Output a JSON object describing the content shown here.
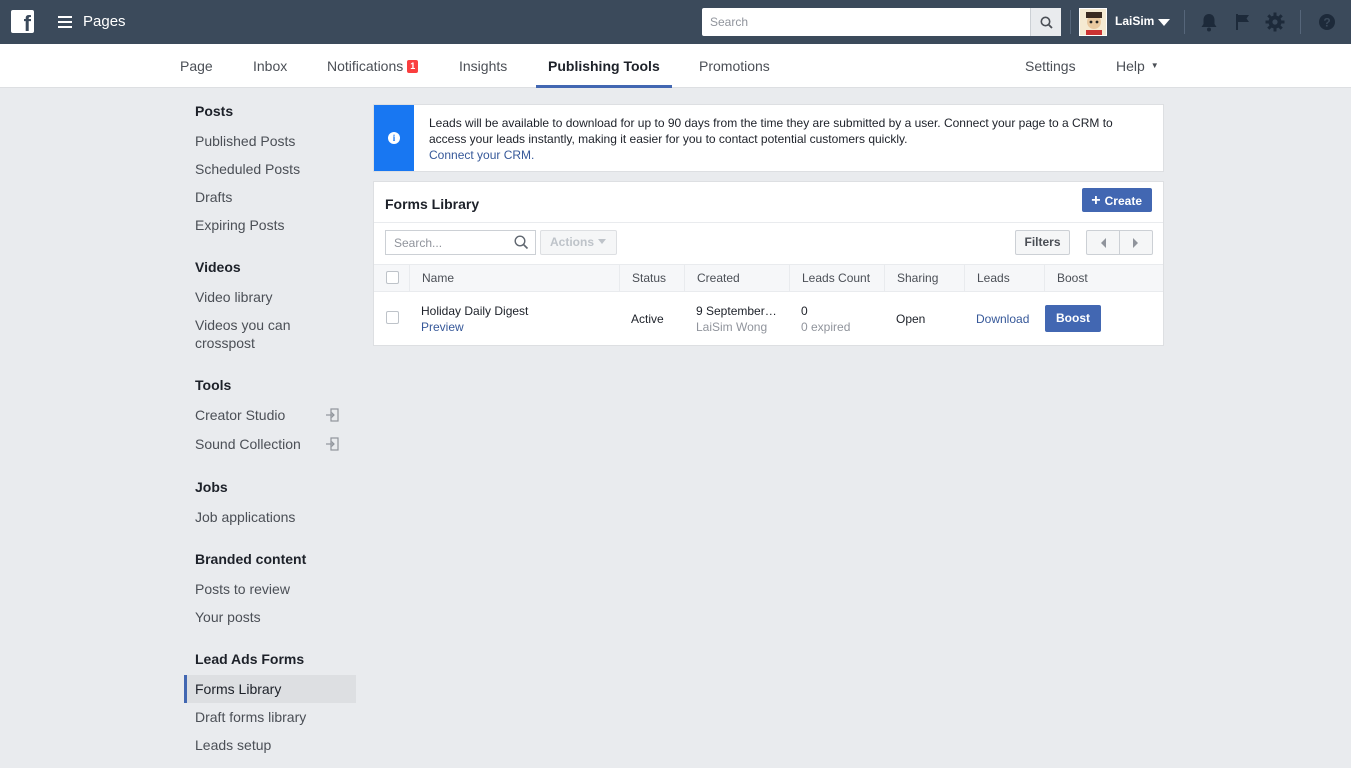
{
  "topbar": {
    "app_title": "Pages",
    "search_placeholder": "Search",
    "username": "LaiSim",
    "icons": [
      "facebook-logo-icon",
      "menu-icon",
      "search-icon",
      "bell-icon",
      "flag-icon",
      "gear-icon",
      "help-icon"
    ]
  },
  "nav": {
    "page": "Page",
    "inbox": "Inbox",
    "notifications": "Notifications",
    "notifications_count": "1",
    "insights": "Insights",
    "publishing_tools": "Publishing Tools",
    "promotions": "Promotions",
    "settings": "Settings",
    "help": "Help",
    "help_caret": "▼",
    "active_tab": "Publishing Tools"
  },
  "sidebar": {
    "posts": {
      "title": "Posts",
      "items": [
        "Published Posts",
        "Scheduled Posts",
        "Drafts",
        "Expiring Posts"
      ]
    },
    "videos": {
      "title": "Videos",
      "items": [
        "Video library",
        "Videos you can crosspost"
      ]
    },
    "tools": {
      "title": "Tools",
      "items": [
        "Creator Studio",
        "Sound Collection"
      ]
    },
    "jobs": {
      "title": "Jobs",
      "items": [
        "Job applications"
      ]
    },
    "branded": {
      "title": "Branded content",
      "items": [
        "Posts to review",
        "Your posts"
      ]
    },
    "lead_ads": {
      "title": "Lead Ads Forms",
      "items": [
        "Forms Library",
        "Draft forms library",
        "Leads setup"
      ]
    },
    "active_item": "Forms Library"
  },
  "banner": {
    "text": "Leads will be available to download for up to 90 days from the time they are submitted by a user. Connect your page to a CRM to access your leads instantly, making it easier for you to contact potential customers quickly.",
    "link": "Connect your CRM."
  },
  "forms_library": {
    "title": "Forms Library",
    "create_label": "Create",
    "search_placeholder": "Search...",
    "actions_label": "Actions",
    "filters_label": "Filters",
    "columns": [
      "Name",
      "Status",
      "Created",
      "Leads Count",
      "Sharing",
      "Leads",
      "Boost"
    ],
    "rows": [
      {
        "name": "Holiday Daily Digest",
        "preview": "Preview",
        "status": "Active",
        "created_date": "9 September…",
        "created_by": "LaiSim Wong",
        "leads_count": "0",
        "expired": "0 expired",
        "sharing": "Open",
        "leads": "Download",
        "boost": "Boost"
      }
    ]
  },
  "colors": {
    "topbar": "#3b4a5b",
    "accent": "#4267b2",
    "info_blue": "#1877f2",
    "badge_red": "#fa3e3e",
    "link": "#365899"
  }
}
